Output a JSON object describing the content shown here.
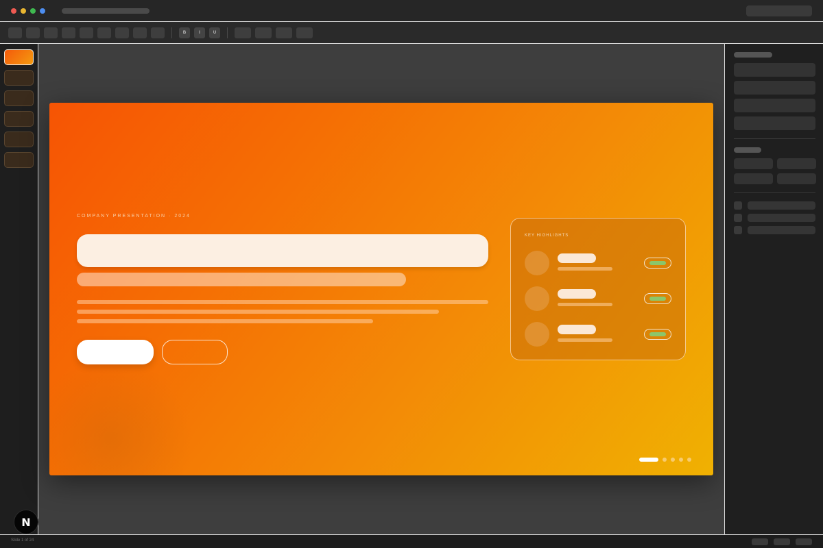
{
  "window": {
    "traffic_lights": [
      "#ee5a52",
      "#e9b631",
      "#3fb950",
      "#4d8ef0"
    ]
  },
  "toolbar": {
    "format_buttons": [
      "B",
      "I",
      "U"
    ]
  },
  "slides_rail": {
    "count": 6,
    "active_index": 0
  },
  "slide": {
    "eyebrow": "COMPANY PRESENTATION · 2024",
    "gradient": [
      "#f65404",
      "#f0b102"
    ],
    "highlights_card": {
      "title": "KEY HIGHLIGHTS",
      "rows": 3,
      "badge_color": "#8bc66a"
    },
    "pagination": {
      "total": 5,
      "active_index": 0
    }
  },
  "floating_logo": {
    "letter": "N"
  },
  "status_bar": {
    "text": "Slide 1 of 24"
  }
}
